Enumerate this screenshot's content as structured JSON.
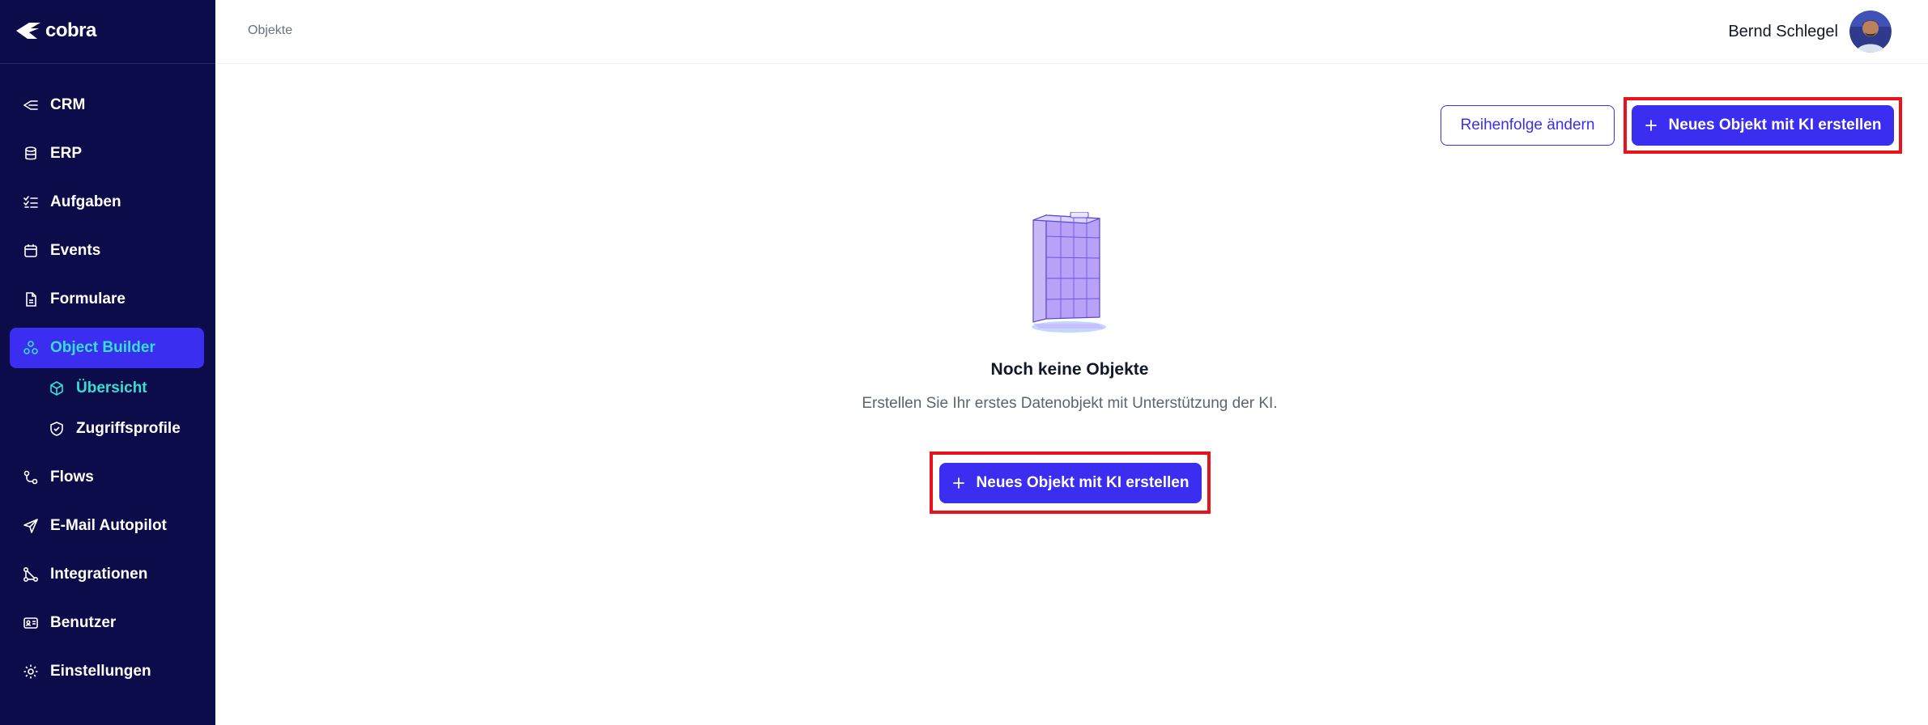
{
  "brand": {
    "name": "cobra"
  },
  "sidebar": {
    "items": [
      {
        "label": "CRM",
        "icon": "crm-arrows-icon"
      },
      {
        "label": "ERP",
        "icon": "database-icon"
      },
      {
        "label": "Aufgaben",
        "icon": "checklist-icon"
      },
      {
        "label": "Events",
        "icon": "calendar-icon"
      },
      {
        "label": "Formulare",
        "icon": "document-icon"
      },
      {
        "label": "Object Builder",
        "icon": "object-builder-icon",
        "active": true
      },
      {
        "label": "Flows",
        "icon": "flow-icon"
      },
      {
        "label": "E-Mail Autopilot",
        "icon": "paper-plane-icon"
      },
      {
        "label": "Integrationen",
        "icon": "integration-icon"
      },
      {
        "label": "Benutzer",
        "icon": "id-card-icon"
      },
      {
        "label": "Einstellungen",
        "icon": "gear-icon"
      }
    ],
    "sub_items": [
      {
        "label": "Übersicht",
        "icon": "cube-icon",
        "active": true
      },
      {
        "label": "Zugriffsprofile",
        "icon": "shield-icon"
      }
    ]
  },
  "header": {
    "breadcrumb": "Objekte",
    "user_name": "Bernd Schlegel"
  },
  "actions": {
    "reorder_label": "Reihenfolge ändern",
    "create_label": "Neues Objekt mit KI erstellen"
  },
  "empty_state": {
    "title": "Noch keine Objekte",
    "subtitle": "Erstellen Sie Ihr erstes Datenobjekt mit Unterstützung der KI.",
    "button_label": "Neues Objekt mit KI erstellen"
  },
  "colors": {
    "sidebar_bg": "#0c0c4a",
    "accent": "#3b2ef0",
    "active_text": "#34e0d0",
    "highlight": "#e8131b"
  }
}
